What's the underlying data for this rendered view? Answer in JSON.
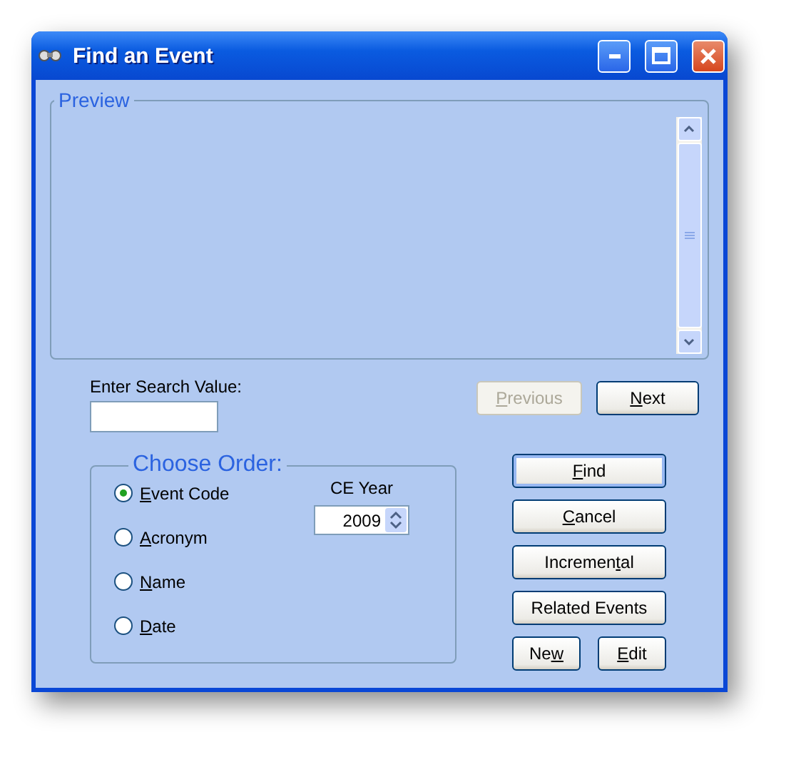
{
  "window": {
    "title": "Find an Event"
  },
  "preview": {
    "legend": "Preview"
  },
  "search": {
    "label": "Enter Search Value:"
  },
  "nav_buttons": [
    {
      "label": [
        {
          "text": "P",
          "underlined": true
        },
        {
          "text": "revious",
          "underlined": false
        }
      ],
      "disabled": true
    },
    {
      "label": [
        {
          "text": "N",
          "underlined": true
        },
        {
          "text": "ext",
          "underlined": false
        }
      ],
      "disabled": false
    }
  ],
  "order": {
    "legend": "Choose Order:",
    "options": [
      {
        "label": [
          {
            "text": "E",
            "underlined": true
          },
          {
            "text": "vent Code",
            "underlined": false
          }
        ],
        "selected": true
      },
      {
        "label": [
          {
            "text": "A",
            "underlined": true
          },
          {
            "text": "cronym",
            "underlined": false
          }
        ],
        "selected": false
      },
      {
        "label": [
          {
            "text": "N",
            "underlined": true
          },
          {
            "text": "ame",
            "underlined": false
          }
        ],
        "selected": false
      },
      {
        "label": [
          {
            "text": "D",
            "underlined": true
          },
          {
            "text": "ate",
            "underlined": false
          }
        ],
        "selected": false
      }
    ],
    "year": {
      "label": "CE Year",
      "value": "2009"
    }
  },
  "action_buttons": [
    {
      "label": [
        {
          "text": "F",
          "underlined": true
        },
        {
          "text": "ind",
          "underlined": false
        }
      ],
      "focused": true
    },
    {
      "label": [
        {
          "text": "C",
          "underlined": true
        },
        {
          "text": "ancel",
          "underlined": false
        }
      ],
      "focused": false
    },
    {
      "label": [
        {
          "text": "Incremen",
          "underlined": false
        },
        {
          "text": "t",
          "underlined": true
        },
        {
          "text": "al",
          "underlined": false
        }
      ],
      "focused": false
    },
    {
      "label": [
        {
          "text": "Related Events",
          "underlined": false
        }
      ],
      "focused": false
    }
  ],
  "bottom_buttons": [
    {
      "label": [
        {
          "text": "Ne",
          "underlined": false
        },
        {
          "text": "w",
          "underlined": true
        }
      ]
    },
    {
      "label": [
        {
          "text": "E",
          "underlined": true
        },
        {
          "text": "dit",
          "underlined": false
        }
      ]
    }
  ]
}
